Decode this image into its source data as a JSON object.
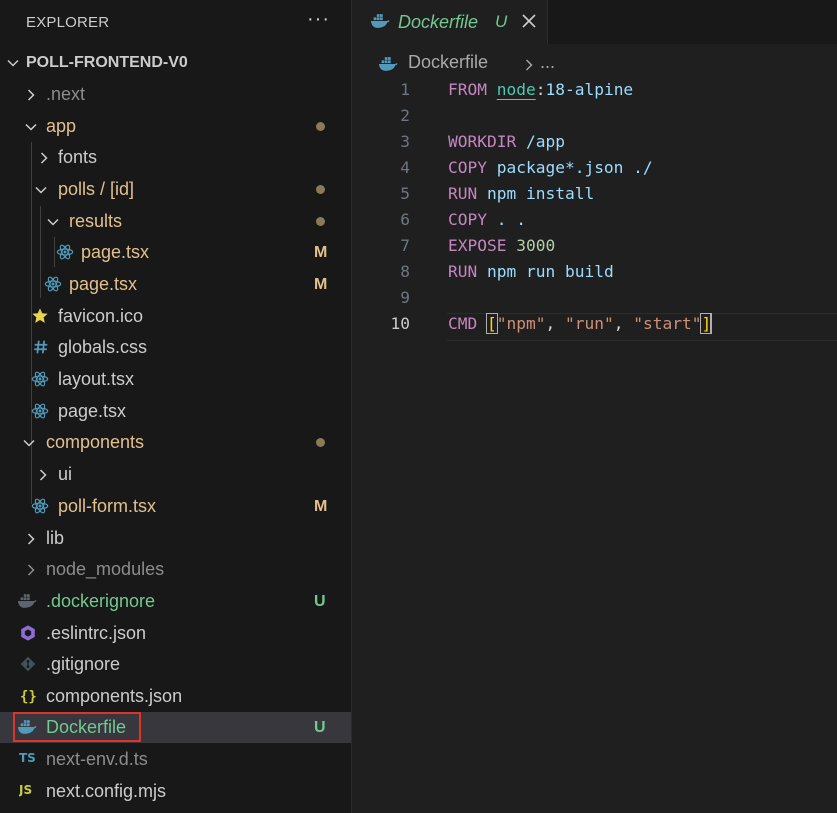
{
  "explorer": {
    "title": "EXPLORER",
    "more_label": "···",
    "project": "POLL-FRONTEND-V0",
    "tree": [
      {
        "label": ".next",
        "badge": ""
      },
      {
        "label": "app",
        "badge": ""
      },
      {
        "label": "fonts",
        "badge": ""
      },
      {
        "label": "polls / [id]",
        "badge": ""
      },
      {
        "label": "results",
        "badge": ""
      },
      {
        "label": "page.tsx",
        "badge": "M"
      },
      {
        "label": "page.tsx",
        "badge": "M"
      },
      {
        "label": "favicon.ico",
        "badge": ""
      },
      {
        "label": "globals.css",
        "badge": ""
      },
      {
        "label": "layout.tsx",
        "badge": ""
      },
      {
        "label": "page.tsx",
        "badge": ""
      },
      {
        "label": "components",
        "badge": ""
      },
      {
        "label": "ui",
        "badge": ""
      },
      {
        "label": "poll-form.tsx",
        "badge": "M"
      },
      {
        "label": "lib",
        "badge": ""
      },
      {
        "label": "node_modules",
        "badge": ""
      },
      {
        "label": ".dockerignore",
        "badge": "U"
      },
      {
        "label": ".eslintrc.json",
        "badge": ""
      },
      {
        "label": ".gitignore",
        "badge": ""
      },
      {
        "label": "components.json",
        "badge": ""
      },
      {
        "label": "Dockerfile",
        "badge": "U"
      },
      {
        "label": "next-env.d.ts",
        "badge": ""
      },
      {
        "label": "next.config.mjs",
        "badge": ""
      }
    ]
  },
  "editor": {
    "tab": {
      "name": "Dockerfile",
      "status": "U"
    },
    "breadcrumb": {
      "file": "Dockerfile",
      "rest": "..."
    },
    "code": {
      "line_numbers": [
        "1",
        "2",
        "3",
        "4",
        "5",
        "6",
        "7",
        "8",
        "9",
        "10"
      ],
      "l1": {
        "kw": "FROM",
        "image": "node",
        "colon": ":",
        "tag": "18-alpine"
      },
      "l3": {
        "kw": "WORKDIR",
        "arg": "/app"
      },
      "l4": {
        "kw": "COPY",
        "arg": "package*.json ./"
      },
      "l5": {
        "kw": "RUN",
        "arg": "npm install"
      },
      "l6": {
        "kw": "COPY",
        "arg": ". ."
      },
      "l7": {
        "kw": "EXPOSE",
        "arg": "3000"
      },
      "l8": {
        "kw": "RUN",
        "arg": "npm run build"
      },
      "l10": {
        "kw": "CMD",
        "open": "[",
        "s1": "\"npm\"",
        "s2": "\"run\"",
        "s3": "\"start\"",
        "comma": ",",
        "close": "]"
      }
    }
  },
  "colors": {
    "untracked": "#73c991",
    "modified": "#e2c08d",
    "selection": "#37373d",
    "highlight_box": "#e0342b"
  },
  "icons": {
    "folder_chevron": "chevron-icon",
    "tsx": "react-icon",
    "css": "hash-icon",
    "ico": "star-icon",
    "docker": "docker-whale-icon",
    "eslint": "eslint-hexagon-icon",
    "git": "git-diamond-icon",
    "json": "braces-icon",
    "ts": "ts-icon",
    "js": "js-icon"
  }
}
